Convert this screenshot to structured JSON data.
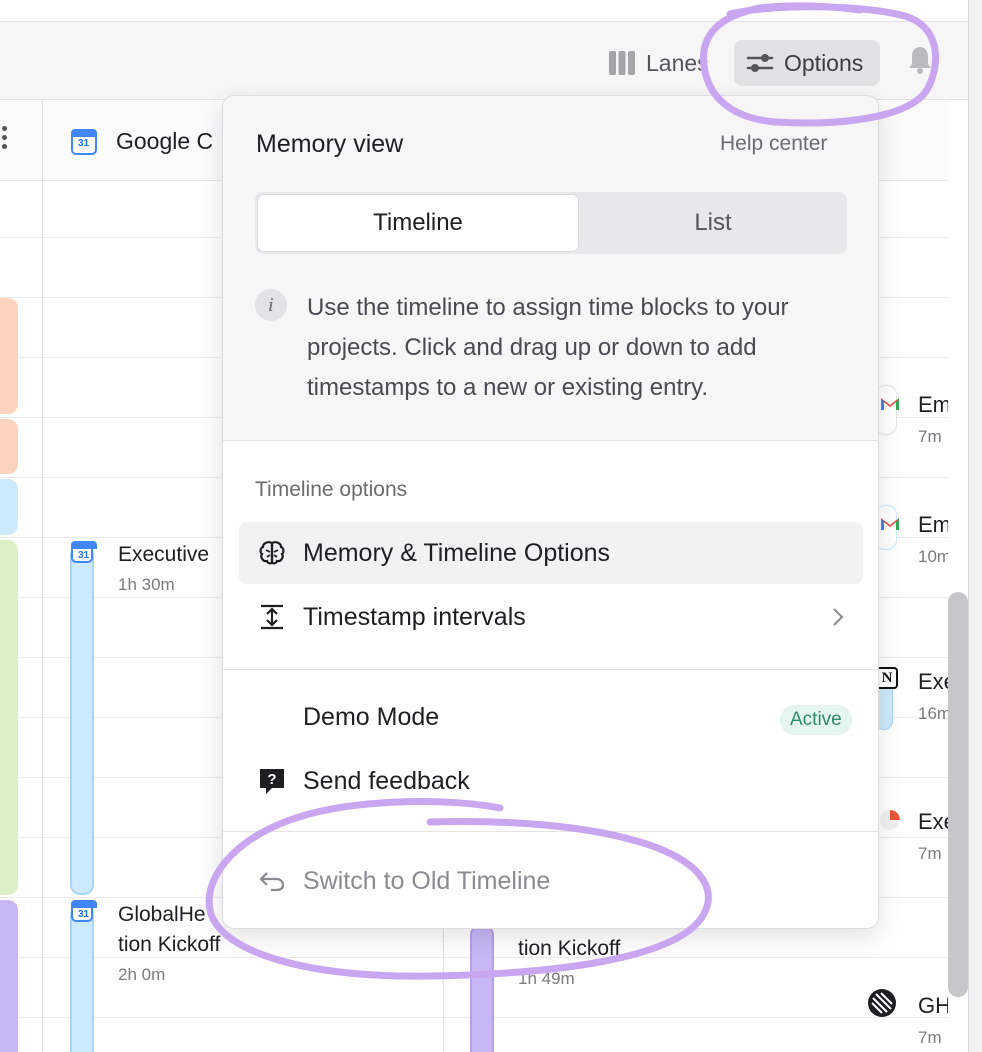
{
  "toolbar": {
    "lanes_label": "Lanes",
    "options_label": "Options",
    "bell_icon": "bell-icon"
  },
  "calendar": {
    "lane_title": "Google C",
    "events": [
      {
        "title": "Executive",
        "duration": "1h 30m"
      },
      {
        "title": "GlobalHe",
        "title2": "tion Kickoff",
        "duration": "2h 0m"
      },
      {
        "title": "tion Kickoff",
        "duration": "1h 49m"
      }
    ],
    "right_events": [
      {
        "title": "Em",
        "duration": "7m"
      },
      {
        "title": "Em",
        "duration": "10m"
      },
      {
        "title": "Exe",
        "duration": "16m"
      },
      {
        "title": "Exe",
        "duration": "7m"
      },
      {
        "title": "GH",
        "duration": "7m"
      }
    ]
  },
  "popover": {
    "title": "Memory view",
    "help_link": "Help center",
    "segments": {
      "timeline": "Timeline",
      "list": "List",
      "selected": "Timeline"
    },
    "info_text": "Use the timeline to assign time blocks to your projects. Click and drag up or down to add timestamps to a new or existing entry.",
    "section_label": "Timeline options",
    "items": {
      "memory_options": "Memory & Timeline Options",
      "timestamp_intervals": "Timestamp intervals",
      "demo_mode": "Demo Mode",
      "demo_badge": "Active",
      "send_feedback": "Send feedback",
      "switch_old": "Switch to Old Timeline"
    }
  },
  "colors": {
    "accent_annotation": "#c9a6f0",
    "active_badge": "#2f8a6a",
    "block_peach": "#fcd3bd",
    "block_blue": "#cdeafc",
    "block_green": "#ddefc4",
    "block_purple": "#c9b6f5"
  }
}
